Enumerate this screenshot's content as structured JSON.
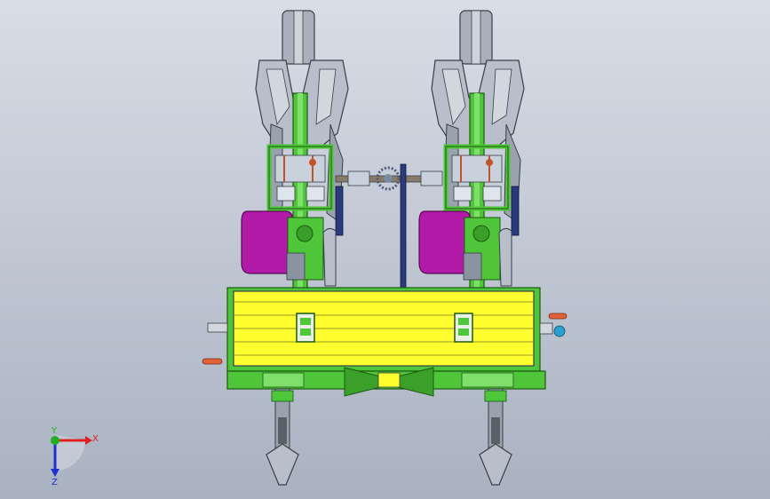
{
  "viewport": {
    "background_top": "#d8dde6",
    "background_bottom": "#a9b2c1"
  },
  "model": {
    "description_colors": {
      "frame_green": "#4fc53a",
      "hopper_yellow": "#ffff30",
      "hopper_magenta": "#b21aa8",
      "wheel_gray": "#a9b0bb",
      "chain_blue": "#2a3a7a",
      "handle_orange": "#e0623a"
    }
  },
  "triad": {
    "x_label": "X",
    "y_label": "Y",
    "z_label": "Z",
    "x_color": "#e02020",
    "y_color": "#20b020",
    "z_color": "#2030d0"
  }
}
